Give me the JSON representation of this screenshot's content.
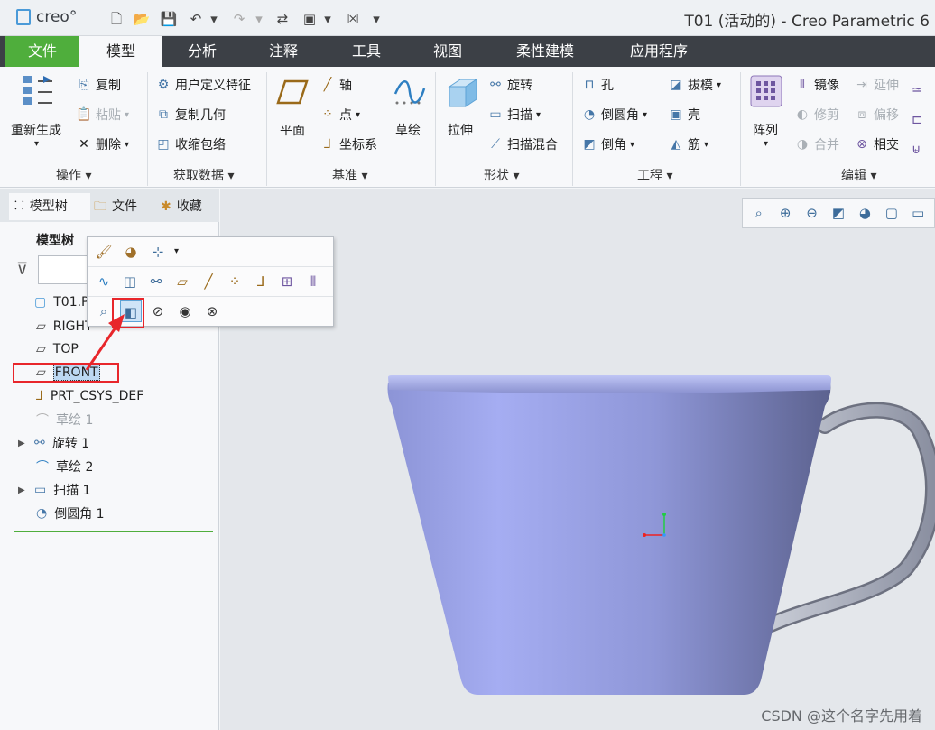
{
  "app": {
    "logo_text": "creo°",
    "window_title": "T01 (活动的) - Creo Parametric 6"
  },
  "quick_access": [
    "new-icon",
    "open-icon",
    "save-icon",
    "undo-icon",
    "redo-icon",
    "regenerate-icon",
    "windows-icon",
    "close-icon",
    "customize-icon"
  ],
  "tabs": [
    "文件",
    "模型",
    "分析",
    "注释",
    "工具",
    "视图",
    "柔性建模",
    "应用程序"
  ],
  "ribbon": {
    "operations": {
      "label": "操作",
      "regenerate": "重新生成",
      "copy": "复制",
      "paste": "粘贴",
      "delete": "删除"
    },
    "get_data": {
      "label": "获取数据",
      "udf": "用户定义特征",
      "copy_geom": "复制几何",
      "shrinkwrap": "收缩包络"
    },
    "datum": {
      "label": "基准",
      "plane": "平面",
      "axis": "轴",
      "point": "点",
      "csys": "坐标系",
      "sketch": "草绘"
    },
    "shapes": {
      "label": "形状",
      "extrude": "拉伸",
      "revolve": "旋转",
      "sweep": "扫描",
      "swept_blend": "扫描混合"
    },
    "engineering": {
      "label": "工程",
      "hole": "孔",
      "round": "倒圆角",
      "chamfer": "倒角",
      "draft": "拔模",
      "shell": "壳",
      "rib": "筋"
    },
    "editing": {
      "label": "编辑",
      "pattern": "阵列",
      "mirror": "镜像",
      "trim": "修剪",
      "merge": "合并",
      "extend": "延伸",
      "offset": "偏移",
      "intersect": "相交"
    }
  },
  "left_panel": {
    "tabs": [
      "模型树",
      "文件",
      "收藏"
    ],
    "header": "模型树",
    "tree": [
      {
        "label": "T01.PRT",
        "icon": "part-icon",
        "dim": false,
        "expander": false
      },
      {
        "label": "RIGHT",
        "icon": "datum-plane-icon",
        "dim": false,
        "expander": false
      },
      {
        "label": "TOP",
        "icon": "datum-plane-icon",
        "dim": false,
        "expander": false
      },
      {
        "label": "FRONT",
        "icon": "datum-plane-icon",
        "dim": false,
        "expander": false,
        "selected": true
      },
      {
        "label": "PRT_CSYS_DEF",
        "icon": "csys-icon",
        "dim": false,
        "expander": false
      },
      {
        "label": "草绘 1",
        "icon": "sketch-icon",
        "dim": true,
        "expander": false
      },
      {
        "label": "旋转 1",
        "icon": "revolve-icon",
        "dim": false,
        "expander": true
      },
      {
        "label": "草绘 2",
        "icon": "sketch-icon",
        "dim": false,
        "expander": false
      },
      {
        "label": "扫描 1",
        "icon": "sweep-icon",
        "dim": false,
        "expander": true
      },
      {
        "label": "倒圆角 1",
        "icon": "round-icon",
        "dim": false,
        "expander": false
      }
    ]
  },
  "popup": {
    "row1": [
      "appearance-icon",
      "color-icon",
      "selection-filter-icon"
    ],
    "row2": [
      "sketch-icon",
      "extrude-icon",
      "revolve-icon",
      "plane-icon",
      "axis-icon",
      "point-icon",
      "csys-icon",
      "pattern-icon",
      "mirror-icon"
    ],
    "row3": [
      "zoom-to-selected-icon",
      "sketch-view-icon",
      "hide-icon",
      "show-icon",
      "unhide-icon"
    ]
  },
  "view_toolbar": [
    "refit-icon",
    "zoom-in-icon",
    "zoom-out-icon",
    "repaint-icon",
    "display-style-icon",
    "saved-orientations-icon",
    "view-manager-icon"
  ],
  "colors": {
    "accent_green": "#4fae3c",
    "tab_bar": "#3c4046",
    "highlight_red": "#e8262b",
    "cup_body": "#9aa3ea",
    "cup_shadow": "#5c628f",
    "handle": "#b8bcc8"
  },
  "watermark": "CSDN @这个名字先用着"
}
